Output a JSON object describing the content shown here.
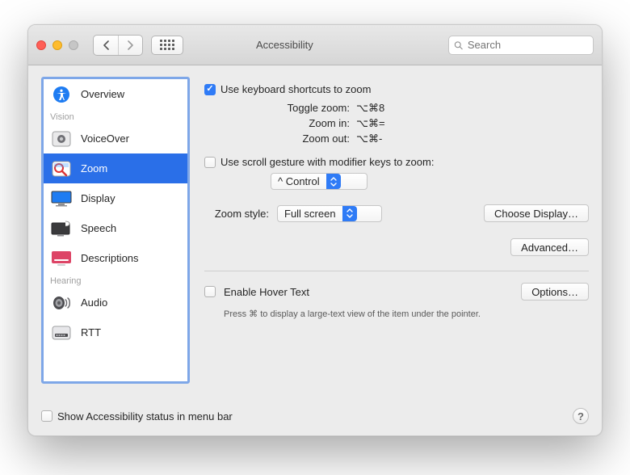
{
  "window": {
    "title": "Accessibility"
  },
  "search": {
    "placeholder": "Search"
  },
  "sidebar": {
    "sections": {
      "vision_label": "Vision",
      "hearing_label": "Hearing"
    },
    "items": {
      "overview": "Overview",
      "voiceover": "VoiceOver",
      "zoom": "Zoom",
      "display": "Display",
      "speech": "Speech",
      "descriptions": "Descriptions",
      "audio": "Audio",
      "rtt": "RTT"
    },
    "selected": "zoom"
  },
  "zoom": {
    "use_shortcuts_label": "Use keyboard shortcuts to zoom",
    "use_shortcuts_checked": true,
    "shortcuts": {
      "toggle_label": "Toggle zoom:",
      "toggle_keys": "⌥⌘8",
      "in_label": "Zoom in:",
      "in_keys": "⌥⌘=",
      "out_label": "Zoom out:",
      "out_keys": "⌥⌘-"
    },
    "scroll_gesture_label": "Use scroll gesture with modifier keys to zoom:",
    "scroll_gesture_checked": false,
    "modifier_value": "^ Control",
    "style_label": "Zoom style:",
    "style_value": "Full screen",
    "choose_display_label": "Choose Display…",
    "advanced_label": "Advanced…",
    "hover_text_label": "Enable Hover Text",
    "hover_text_checked": false,
    "hover_options_label": "Options…",
    "hover_hint": "Press ⌘ to display a large-text view of the item under the pointer."
  },
  "footer": {
    "status_label": "Show Accessibility status in menu bar",
    "status_checked": false,
    "help": "?"
  }
}
